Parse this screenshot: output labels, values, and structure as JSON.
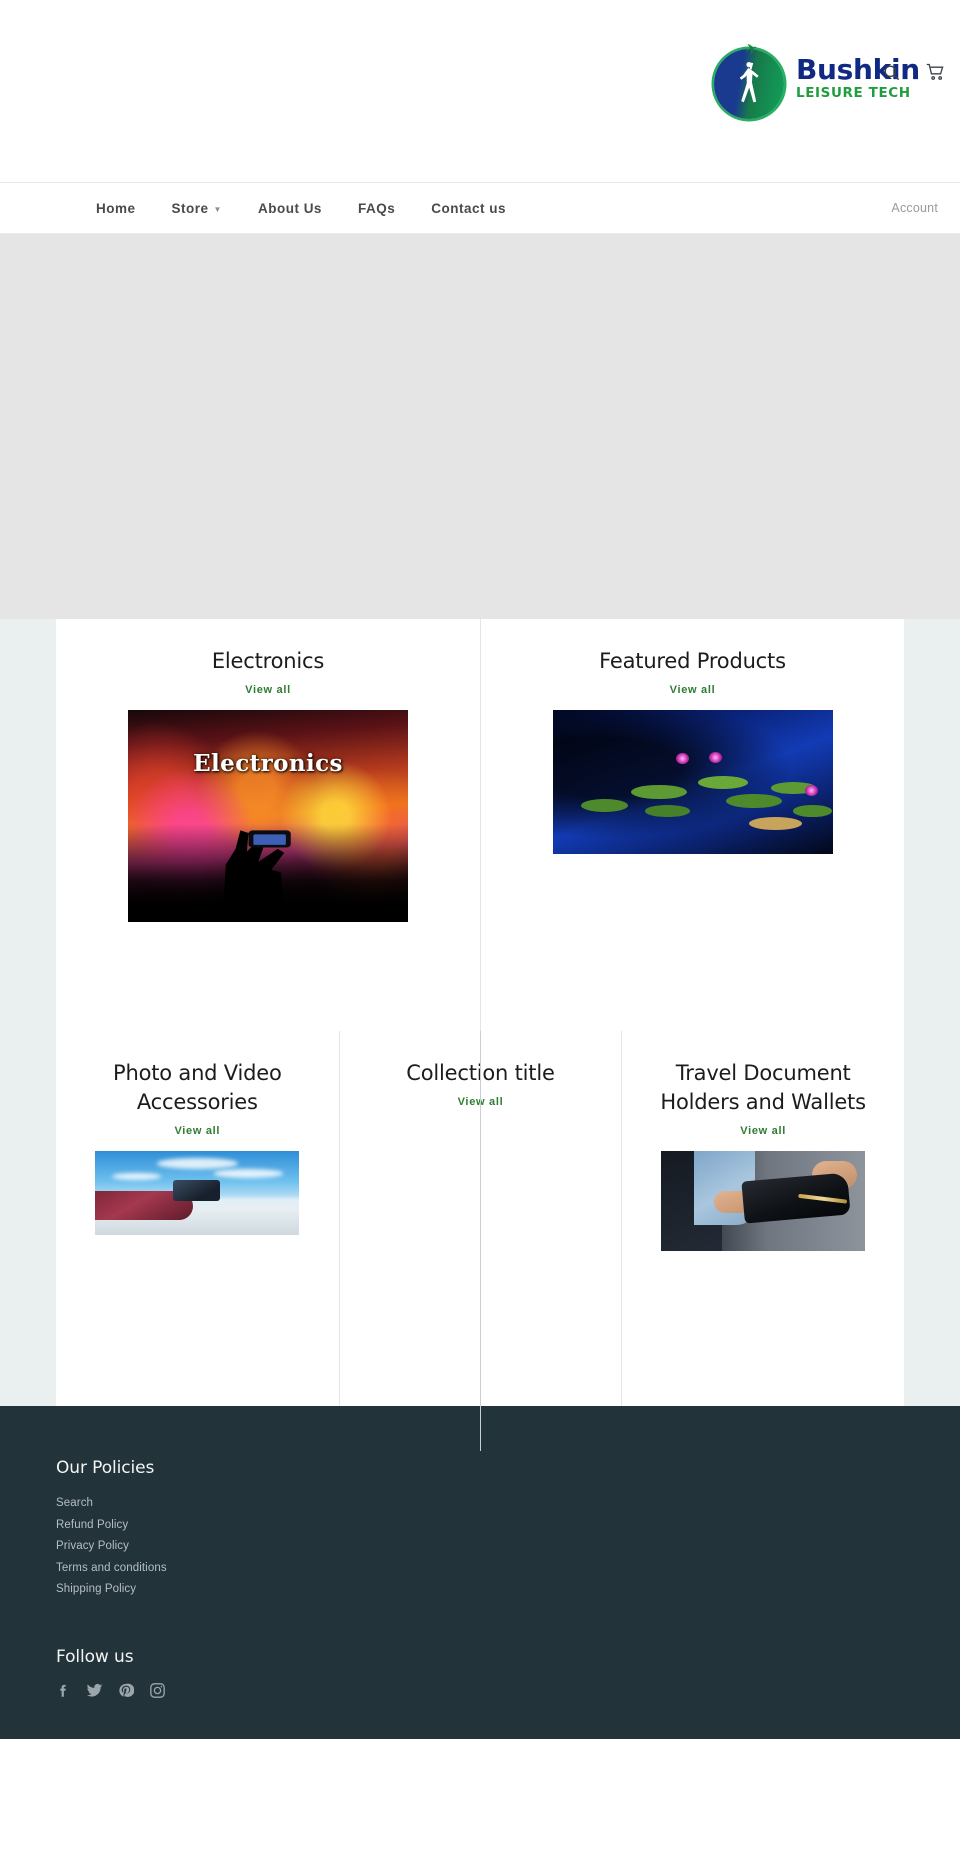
{
  "header": {
    "logo": {
      "name": "Bushkin",
      "tagline": "LEISURE TECH",
      "mark": "globe-traveler-logo"
    },
    "icons": [
      {
        "name": "search-icon",
        "label": "Search"
      },
      {
        "name": "cart-icon",
        "label": "Cart"
      }
    ]
  },
  "nav": {
    "items": [
      {
        "label": "Home",
        "has_dropdown": false
      },
      {
        "label": "Store",
        "has_dropdown": true
      },
      {
        "label": "About Us",
        "has_dropdown": false
      },
      {
        "label": "FAQs",
        "has_dropdown": false
      },
      {
        "label": "Contact us",
        "has_dropdown": false
      }
    ],
    "account_label": "Account"
  },
  "hero": {
    "placeholder_color": "#e5e5e5"
  },
  "collections": {
    "view_all_label": "View all",
    "row_top": [
      {
        "title": "Electronics",
        "image_alt": "concert-crowd-photo",
        "image_overlay_text": "Electronics",
        "has_image": true
      },
      {
        "title": "Featured Products",
        "image_alt": "water-lilies-pond-photo",
        "image_overlay_text": "",
        "has_image": true
      }
    ],
    "row_bottom": [
      {
        "title": "Photo and Video Accessories",
        "image_alt": "hand-holding-camera-photo",
        "has_image": true
      },
      {
        "title": "Collection title",
        "image_alt": "",
        "has_image": false
      },
      {
        "title": "Travel Document Holders and Wallets",
        "image_alt": "man-holding-leather-wallet-photo",
        "has_image": true
      }
    ]
  },
  "footer": {
    "policies_heading": "Our Policies",
    "policy_links": [
      "Search",
      "Refund Policy",
      "Privacy Policy",
      "Terms and conditions",
      "Shipping Policy"
    ],
    "follow_heading": "Follow us",
    "social": [
      {
        "name": "facebook-icon",
        "label": "Facebook"
      },
      {
        "name": "twitter-icon",
        "label": "Twitter"
      },
      {
        "name": "pinterest-icon",
        "label": "Pinterest"
      },
      {
        "name": "instagram-icon",
        "label": "Instagram"
      }
    ]
  },
  "colors": {
    "brand_blue": "#102a83",
    "brand_green": "#1f9e3f",
    "link_green": "#2e7d32",
    "footer_bg": "#22333a",
    "page_bg": "#eaeff0",
    "hero_bg": "#e5e5e5"
  }
}
